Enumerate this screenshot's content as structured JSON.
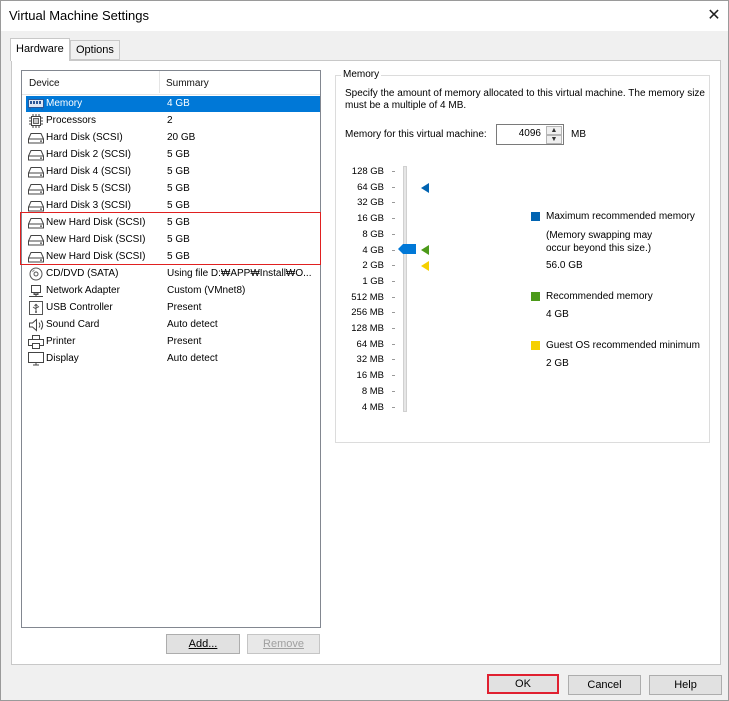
{
  "window": {
    "title": "Virtual Machine Settings",
    "close_glyph": "✕"
  },
  "tabs": [
    {
      "label": "Hardware"
    },
    {
      "label": "Options"
    }
  ],
  "devices": {
    "col_device": "Device",
    "col_summary": "Summary",
    "rows": [
      {
        "name": "Memory",
        "summary": "4 GB",
        "icon": "memory-icon"
      },
      {
        "name": "Processors",
        "summary": "2",
        "icon": "processor-icon"
      },
      {
        "name": "Hard Disk (SCSI)",
        "summary": "20 GB",
        "icon": "hard-disk-icon"
      },
      {
        "name": "Hard Disk 2 (SCSI)",
        "summary": "5 GB",
        "icon": "hard-disk-icon"
      },
      {
        "name": "Hard Disk 4 (SCSI)",
        "summary": "5 GB",
        "icon": "hard-disk-icon"
      },
      {
        "name": "Hard Disk 5 (SCSI)",
        "summary": "5 GB",
        "icon": "hard-disk-icon"
      },
      {
        "name": "Hard Disk 3 (SCSI)",
        "summary": "5 GB",
        "icon": "hard-disk-icon"
      },
      {
        "name": "New Hard Disk (SCSI)",
        "summary": "5 GB",
        "icon": "hard-disk-icon"
      },
      {
        "name": "New Hard Disk (SCSI)",
        "summary": "5 GB",
        "icon": "hard-disk-icon"
      },
      {
        "name": "New Hard Disk (SCSI)",
        "summary": "5 GB",
        "icon": "hard-disk-icon"
      },
      {
        "name": "CD/DVD (SATA)",
        "summary": "Using file D:₩APP₩Install₩O...",
        "icon": "cd-dvd-icon"
      },
      {
        "name": "Network Adapter",
        "summary": "Custom (VMnet8)",
        "icon": "network-adapter-icon"
      },
      {
        "name": "USB Controller",
        "summary": "Present",
        "icon": "usb-icon"
      },
      {
        "name": "Sound Card",
        "summary": "Auto detect",
        "icon": "speaker-icon"
      },
      {
        "name": "Printer",
        "summary": "Present",
        "icon": "printer-icon"
      },
      {
        "name": "Display",
        "summary": "Auto detect",
        "icon": "monitor-icon"
      }
    ],
    "selected_index": 0,
    "add_label": "Add...",
    "remove_label": "Remove"
  },
  "memory": {
    "group_title": "Memory",
    "description": "Specify the amount of memory allocated to this virtual machine. The memory size must be a multiple of 4 MB.",
    "field_label": "Memory for this virtual machine:",
    "value": "4096",
    "unit": "MB",
    "scale": [
      "128 GB",
      "64 GB",
      "32 GB",
      "16 GB",
      "8 GB",
      "4 GB",
      "2 GB",
      "1 GB",
      "512 MB",
      "256 MB",
      "128 MB",
      "64 MB",
      "32 MB",
      "16 MB",
      "8 MB",
      "4 MB"
    ],
    "legend": {
      "max_label": "Maximum recommended memory",
      "max_note": "(Memory swapping may occur beyond this size.)",
      "max_value": "56.0 GB",
      "rec_label": "Recommended memory",
      "rec_value": "4 GB",
      "min_label": "Guest OS recommended minimum",
      "min_value": "2 GB"
    },
    "colors": {
      "max": "#0063b1",
      "rec": "#4c9a1a",
      "min": "#f5d000",
      "thumb": "#0078d7"
    }
  },
  "footer": {
    "ok_label": "OK",
    "cancel_label": "Cancel",
    "help_label": "Help"
  }
}
